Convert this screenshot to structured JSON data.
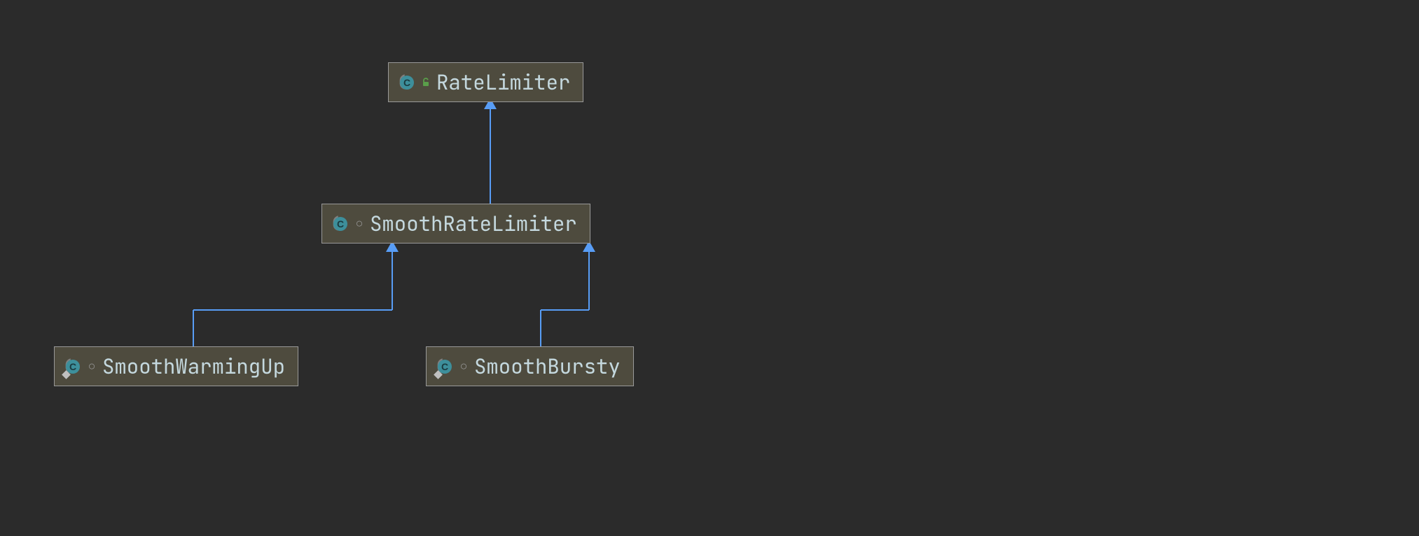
{
  "diagram": {
    "nodes": {
      "rate_limiter": {
        "label": "RateLimiter",
        "icon": "abstract-class",
        "visibility": "public",
        "static": false
      },
      "smooth_rate_limiter": {
        "label": "SmoothRateLimiter",
        "icon": "abstract-class",
        "visibility": "package-private",
        "static": false
      },
      "smooth_warming_up": {
        "label": "SmoothWarmingUp",
        "icon": "abstract-class",
        "visibility": "package-private",
        "static": true
      },
      "smooth_bursty": {
        "label": "SmoothBursty",
        "icon": "abstract-class",
        "visibility": "package-private",
        "static": true
      }
    },
    "relationships": [
      {
        "from": "smooth_rate_limiter",
        "to": "rate_limiter",
        "type": "extends"
      },
      {
        "from": "smooth_warming_up",
        "to": "smooth_rate_limiter",
        "type": "extends"
      },
      {
        "from": "smooth_bursty",
        "to": "smooth_rate_limiter",
        "type": "extends"
      }
    ],
    "colors": {
      "background": "#2b2b2b",
      "node_bg": "#4e4b3e",
      "node_border": "#999999",
      "text": "#c4d8de",
      "connector": "#589df6",
      "class_icon": "#3d8f9b"
    }
  }
}
